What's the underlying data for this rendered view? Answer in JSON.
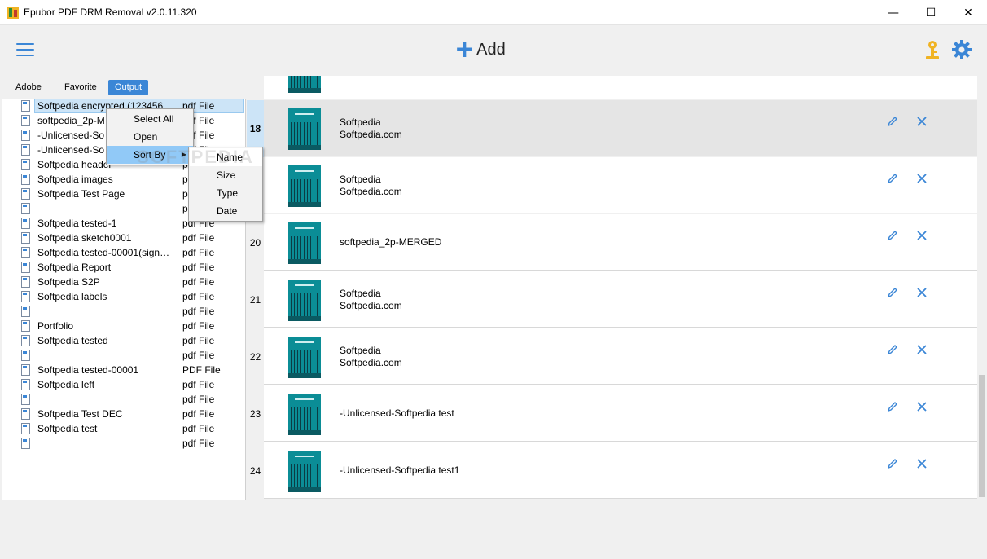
{
  "window": {
    "title": "Epubor PDF DRM Removal v2.0.11.320",
    "minimize": "—",
    "maximize": "☐",
    "close": "✕"
  },
  "toolbar": {
    "add_label": "Add",
    "add_symbol": "+"
  },
  "tabs": [
    {
      "label": "Adobe"
    },
    {
      "label": "Favorite"
    },
    {
      "label": "Output",
      "active": true
    }
  ],
  "files": [
    {
      "name": "Softpedia encrypted (123456",
      "type": "pdf File",
      "selected": true
    },
    {
      "name": "softpedia_2p-M",
      "type": "pdf File"
    },
    {
      "name": "-Unlicensed-So",
      "type": "pdf File"
    },
    {
      "name": "-Unlicensed-So",
      "type": "pdf File"
    },
    {
      "name": "Softpedia header",
      "type": "pdf File"
    },
    {
      "name": "Softpedia images",
      "type": "p"
    },
    {
      "name": "Softpedia Test Page",
      "type": "p"
    },
    {
      "name": "",
      "type": "p"
    },
    {
      "name": "Softpedia tested-1",
      "type": "pdf File"
    },
    {
      "name": "Softpedia sketch0001",
      "type": "pdf File"
    },
    {
      "name": "Softpedia tested-00001(sign…",
      "type": "pdf File"
    },
    {
      "name": "Softpedia Report",
      "type": "pdf File"
    },
    {
      "name": "Softpedia S2P",
      "type": "pdf File"
    },
    {
      "name": "Softpedia labels",
      "type": "pdf File"
    },
    {
      "name": "",
      "type": "pdf File"
    },
    {
      "name": "Portfolio",
      "type": "pdf File"
    },
    {
      "name": "Softpedia tested",
      "type": "pdf File"
    },
    {
      "name": "",
      "type": "pdf File"
    },
    {
      "name": "Softpedia tested-00001",
      "type": "PDF File"
    },
    {
      "name": "Softpedia left",
      "type": "pdf File"
    },
    {
      "name": "",
      "type": "pdf File"
    },
    {
      "name": "Softpedia Test DEC",
      "type": "pdf File"
    },
    {
      "name": "Softpedia test",
      "type": "pdf File"
    },
    {
      "name": "",
      "type": "pdf File"
    }
  ],
  "context_menu": {
    "items": [
      "Select All",
      "Open",
      "Sort By"
    ],
    "submenu": [
      "Name",
      "Size",
      "Type",
      "Date"
    ],
    "arrow": "▶",
    "watermark": "SOFTPEDIA"
  },
  "books": [
    {
      "num": "",
      "title": "",
      "author": ""
    },
    {
      "num": "18",
      "title": "Softpedia",
      "author": "Softpedia.com",
      "selected": true
    },
    {
      "num": "",
      "title": "Softpedia",
      "author": "Softpedia.com"
    },
    {
      "num": "20",
      "title": "softpedia_2p-MERGED",
      "author": ""
    },
    {
      "num": "21",
      "title": "Softpedia",
      "author": "Softpedia.com"
    },
    {
      "num": "22",
      "title": "Softpedia",
      "author": "Softpedia.com"
    },
    {
      "num": "23",
      "title": "-Unlicensed-Softpedia test",
      "author": ""
    },
    {
      "num": "24",
      "title": "-Unlicensed-Softpedia test1",
      "author": ""
    }
  ],
  "colors": {
    "accent": "#3b86d6",
    "key": "#f0b323",
    "selection": "#cce4f7",
    "thumbnail": "#0b8d96"
  }
}
